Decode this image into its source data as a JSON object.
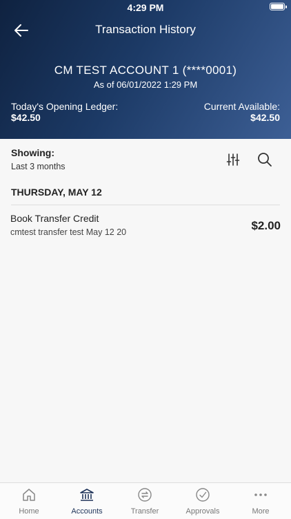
{
  "status_bar": {
    "time": "4:29 PM"
  },
  "nav": {
    "title": "Transaction History"
  },
  "account": {
    "name": "CM TEST ACCOUNT 1 (****0001)",
    "as_of": "As of 06/01/2022 1:29 PM",
    "opening_ledger_label": "Today's Opening Ledger:",
    "opening_ledger_value": "$42.50",
    "current_available_label": "Current Available:",
    "current_available_value": "$42.50"
  },
  "filter": {
    "label": "Showing:",
    "value": "Last 3 months"
  },
  "groups": [
    {
      "date": "THURSDAY, MAY 12",
      "transactions": [
        {
          "title": "Book Transfer Credit",
          "description": "cmtest transfer test May 12 20",
          "amount": "$2.00"
        }
      ]
    }
  ],
  "tabs": [
    {
      "label": "Home",
      "icon": "home-icon"
    },
    {
      "label": "Accounts",
      "icon": "bank-icon"
    },
    {
      "label": "Transfer",
      "icon": "transfer-icon"
    },
    {
      "label": "Approvals",
      "icon": "checkmark-circle-icon"
    },
    {
      "label": "More",
      "icon": "more-dots-icon"
    }
  ],
  "colors": {
    "header_dark": "#0f2240",
    "header_light": "#3d5f95",
    "active_tab": "#1c3157"
  }
}
